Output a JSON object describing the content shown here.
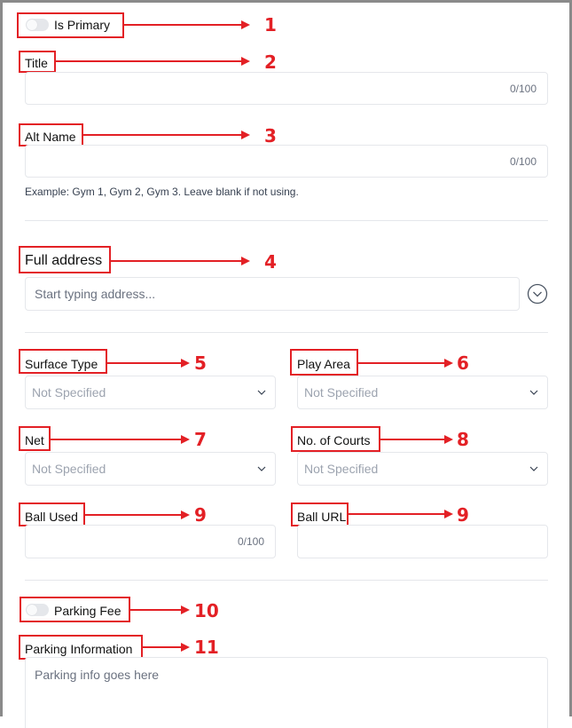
{
  "form": {
    "is_primary": {
      "label": "Is Primary",
      "checked": false
    },
    "title": {
      "label": "Title",
      "value": "",
      "counter": "0/100"
    },
    "alt_name": {
      "label": "Alt Name",
      "value": "",
      "counter": "0/100",
      "hint": "Example: Gym 1, Gym 2, Gym 3. Leave blank if not using."
    },
    "full_address": {
      "label": "Full address",
      "placeholder": "Start typing address...",
      "expand_icon": "chevron-down-circle-icon"
    },
    "surface_type": {
      "label": "Surface Type",
      "selected": "Not Specified"
    },
    "play_area": {
      "label": "Play Area",
      "selected": "Not Specified"
    },
    "net": {
      "label": "Net",
      "selected": "Not Specified"
    },
    "no_of_courts": {
      "label": "No. of Courts",
      "selected": "Not Specified"
    },
    "ball_used": {
      "label": "Ball Used",
      "value": "",
      "counter": "0/100"
    },
    "ball_url": {
      "label": "Ball URL",
      "value": ""
    },
    "parking_fee": {
      "label": "Parking Fee",
      "checked": false
    },
    "parking_information": {
      "label": "Parking Information",
      "placeholder": "Parking info goes here"
    }
  },
  "annotations": {
    "color": "#e32025",
    "markers": [
      "1",
      "2",
      "3",
      "4",
      "5",
      "6",
      "7",
      "8",
      "9",
      "9",
      "10",
      "11"
    ]
  }
}
